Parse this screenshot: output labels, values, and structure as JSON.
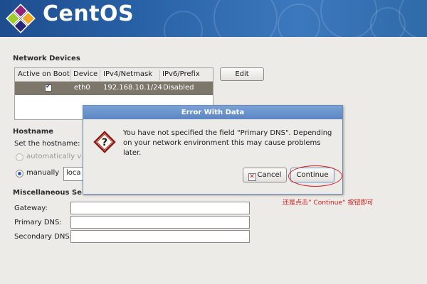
{
  "banner": {
    "title": "CentOS",
    "logo_icon": "centos-logo-icon"
  },
  "network_devices": {
    "title": "Network Devices",
    "columns": [
      "Active on Boot",
      "Device",
      "IPv4/Netmask",
      "IPv6/Prefix"
    ],
    "rows": [
      {
        "active": true,
        "device": "eth0",
        "ipv4": "192.168.10.1/24",
        "ipv6": "Disabled"
      }
    ],
    "edit_label": "Edit"
  },
  "hostname": {
    "title": "Hostname",
    "set_label": "Set the hostname:",
    "auto_label": "automatically v",
    "manual_label": "manually",
    "manual_value": "loca"
  },
  "misc": {
    "title": "Miscellaneous Se",
    "gateway_label": "Gateway:",
    "primary_dns_label": "Primary DNS:",
    "secondary_dns_label": "Secondary DNS:",
    "gateway_value": "",
    "primary_dns_value": "",
    "secondary_dns_value": ""
  },
  "dialog": {
    "title": "Error With Data",
    "message": "You have not specified the field \"Primary DNS\".  Depending on your network environment this may cause problems later.",
    "cancel_label": "Cancel",
    "continue_label": "Continue",
    "icon": "question-icon"
  },
  "annotation": {
    "note": "还是点击” Continue“ 按钮即可",
    "color": "#d21b1b"
  },
  "colors": {
    "banner": "#2a63a8",
    "selected_row": "#7d776b",
    "dialog_title": "#6a93cc"
  }
}
